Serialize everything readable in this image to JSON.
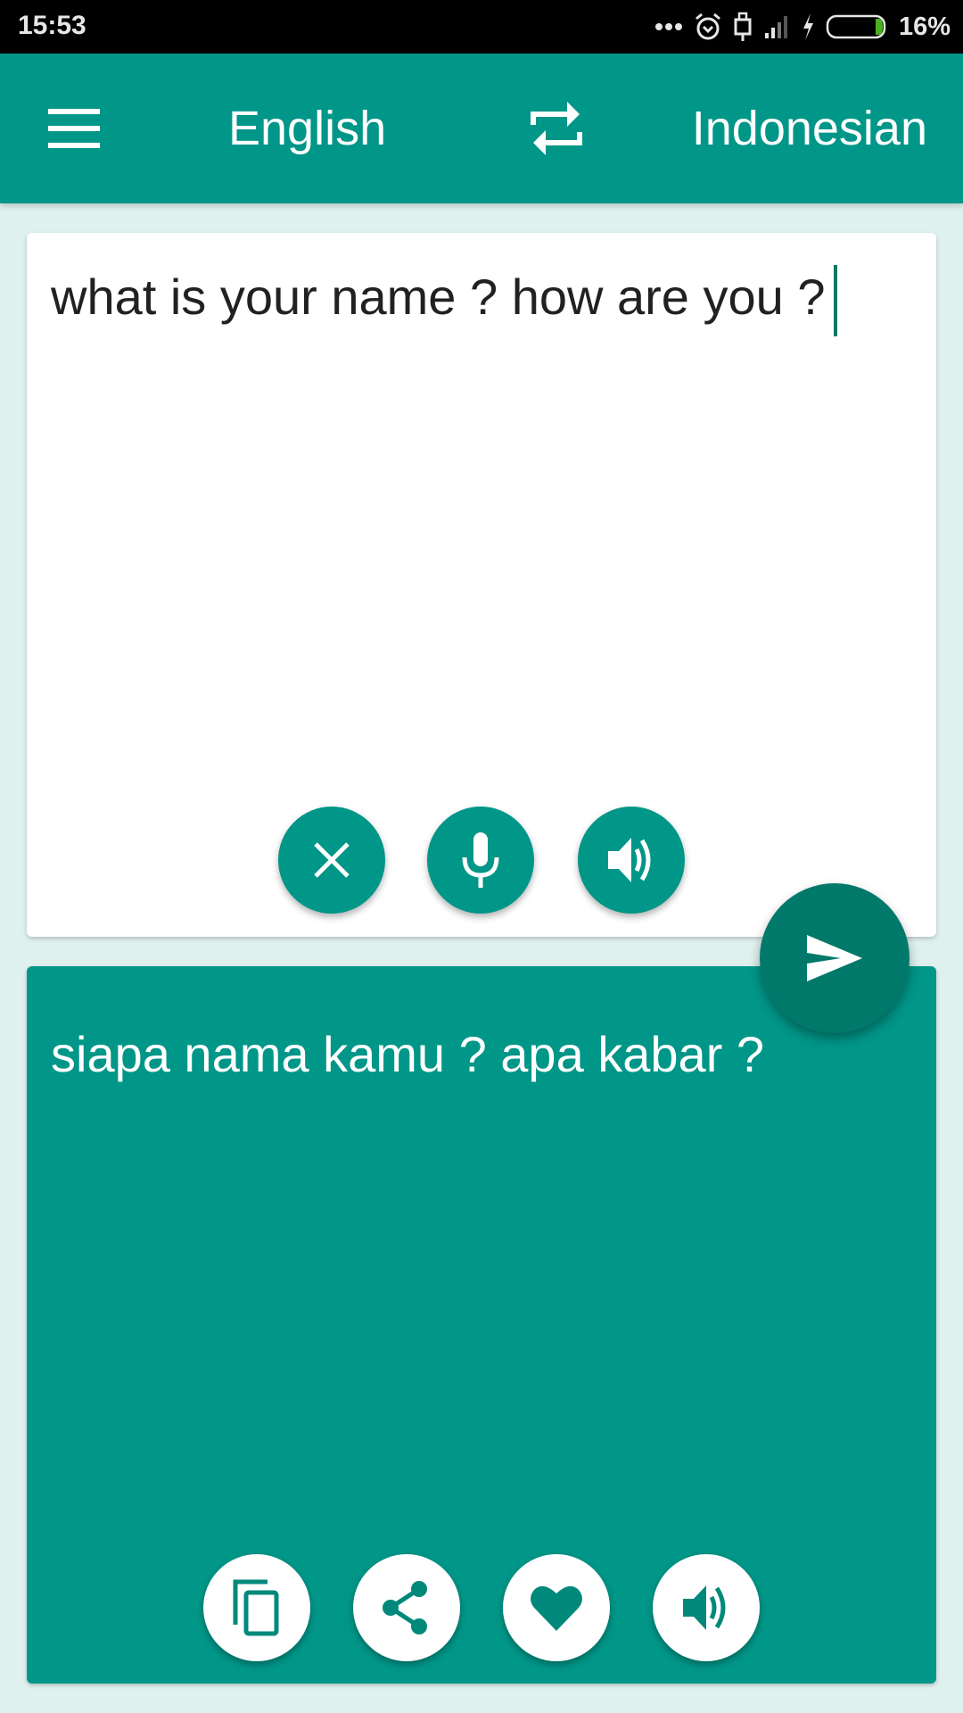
{
  "status_bar": {
    "time": "15:53",
    "battery_percent": "16%",
    "icons": [
      "more-dots-icon",
      "alarm-icon",
      "usb-icon",
      "signal-icon",
      "charging-icon",
      "battery-icon"
    ]
  },
  "toolbar": {
    "menu_icon": "hamburger-menu-icon",
    "source_language": "English",
    "swap_icon": "swap-languages-icon",
    "target_language": "Indonesian"
  },
  "input_card": {
    "text": "what is your name ? how are you ?",
    "buttons": [
      {
        "name": "clear",
        "icon": "close-icon"
      },
      {
        "name": "voice-input",
        "icon": "microphone-icon"
      },
      {
        "name": "speak-source",
        "icon": "speaker-icon"
      }
    ]
  },
  "translate_button": {
    "icon": "send-icon"
  },
  "output_card": {
    "text": "siapa nama kamu ? apa kabar ?",
    "buttons": [
      {
        "name": "copy",
        "icon": "copy-icon"
      },
      {
        "name": "share",
        "icon": "share-icon"
      },
      {
        "name": "favorite",
        "icon": "heart-icon"
      },
      {
        "name": "speak-translation",
        "icon": "speaker-icon"
      }
    ]
  },
  "colors": {
    "primary": "#009688",
    "primary_dark": "#00796B",
    "background": "#DFF1EF",
    "battery_level": "#4CAF1F"
  }
}
